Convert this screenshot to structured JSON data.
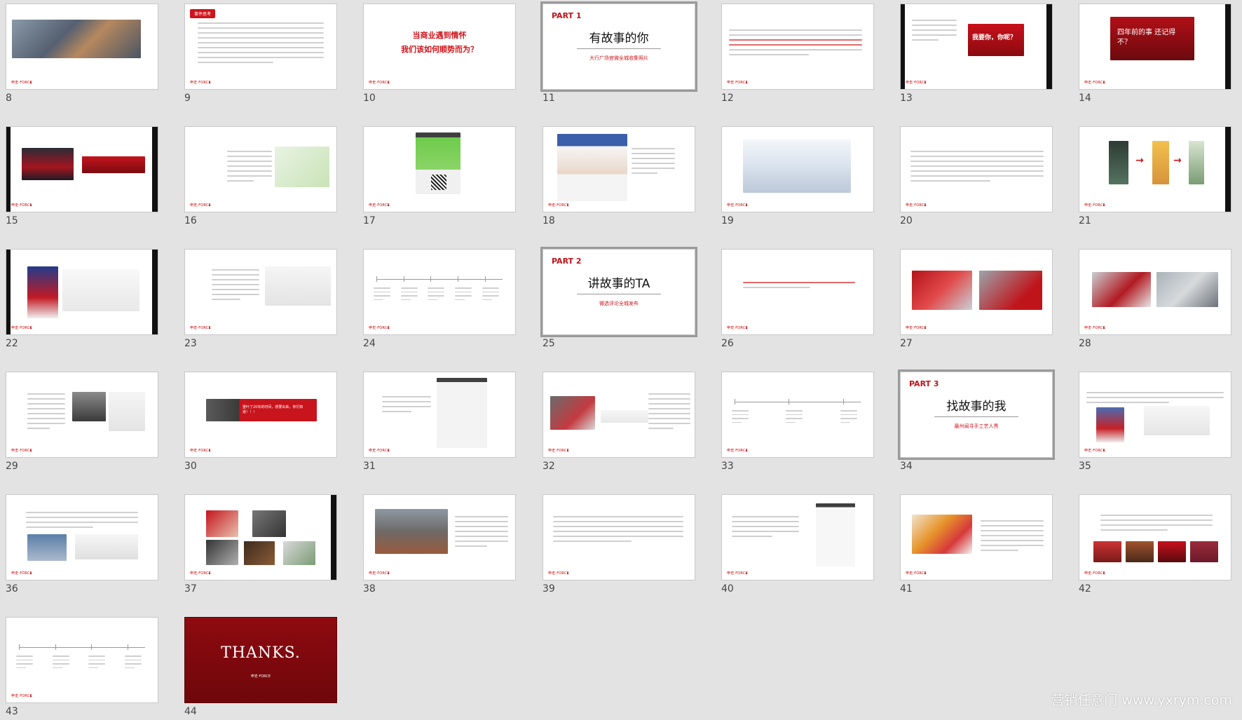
{
  "slide_numbers": [
    "8",
    "9",
    "10",
    "11",
    "12",
    "13",
    "14",
    "15",
    "16",
    "17",
    "18",
    "19",
    "20",
    "21",
    "22",
    "23",
    "24",
    "25",
    "26",
    "27",
    "28",
    "29",
    "30",
    "31",
    "32",
    "33",
    "34",
    "35",
    "36",
    "37",
    "38",
    "39",
    "40",
    "41",
    "42",
    "43",
    "44"
  ],
  "footer_brand": "申史·FORCE",
  "slide9": {
    "tag": "事件思考"
  },
  "slide10": {
    "line1": "当商业遇到情怀",
    "line2": "我们该如何顺势而为？"
  },
  "part1": {
    "label": "PART 1",
    "title": "有故事的你",
    "subtitle": "大行广场官微全城收集照片"
  },
  "part2": {
    "label": "PART 2",
    "title": "讲故事的TA",
    "subtitle": "微选评论全城发布"
  },
  "part3": {
    "label": "PART 3",
    "title": "找故事的我",
    "subtitle": "最州闻寻手工艺人秀"
  },
  "slide13": {
    "sign": "我要你，你呢？"
  },
  "slide14": {
    "sign": "四年前的事 还记得不？"
  },
  "slide30": {
    "banner": "重叶了20年的时间，想要出来，你们知道！！！"
  },
  "slide44": {
    "thanks": "THANKS."
  },
  "watermark": "营销任意门 www.yxrym.com",
  "colors": {
    "accent": "#d0141b",
    "dark_red": "#8b0b0f",
    "background": "#e3e3e3"
  }
}
